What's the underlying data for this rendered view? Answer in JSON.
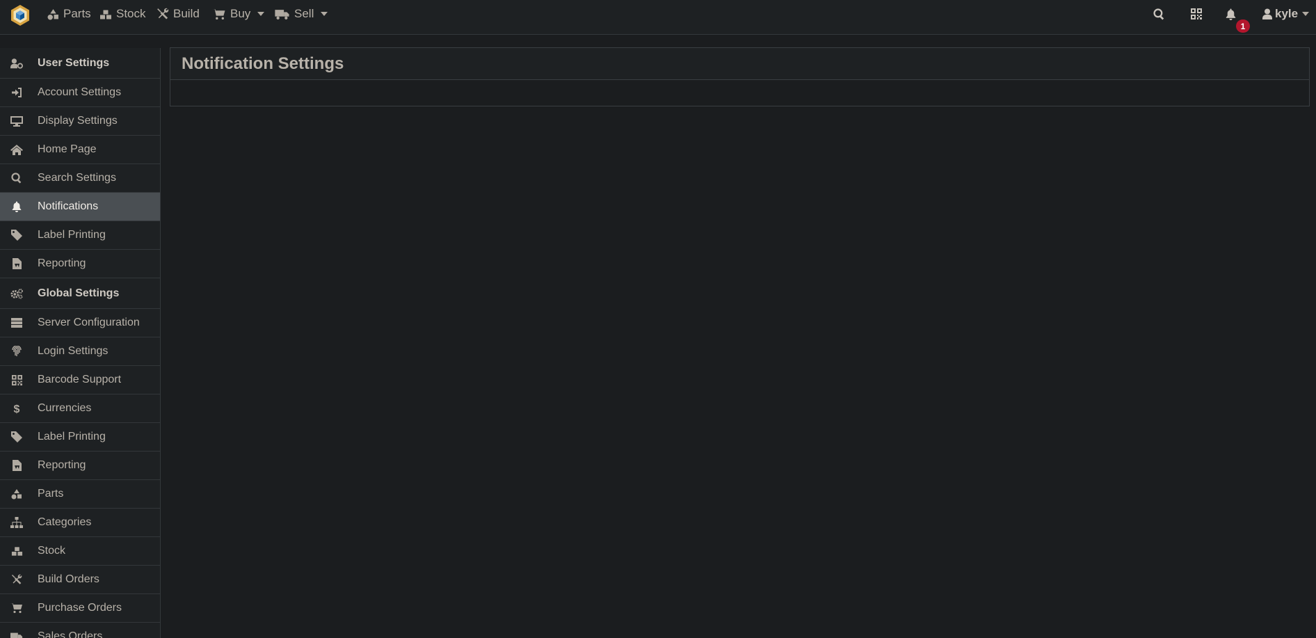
{
  "navbar": {
    "links": [
      {
        "label": "Parts",
        "icon": "shapes-icon",
        "dropdown": false
      },
      {
        "label": "Stock",
        "icon": "boxes-icon",
        "dropdown": false
      },
      {
        "label": "Build",
        "icon": "tools-icon",
        "dropdown": false
      },
      {
        "label": "Buy",
        "icon": "shopping-cart-icon",
        "dropdown": true
      },
      {
        "label": "Sell",
        "icon": "truck-icon",
        "dropdown": true
      }
    ],
    "notification_count": "1",
    "user": "kyle"
  },
  "sidebar": {
    "items": [
      {
        "label": "User Settings",
        "icon": "user-cog-icon",
        "type": "header"
      },
      {
        "label": "Account Settings",
        "icon": "sign-in-icon"
      },
      {
        "label": "Display Settings",
        "icon": "desktop-icon"
      },
      {
        "label": "Home Page",
        "icon": "home-icon"
      },
      {
        "label": "Search Settings",
        "icon": "search-icon"
      },
      {
        "label": "Notifications",
        "icon": "bell-icon",
        "active": true
      },
      {
        "label": "Label Printing",
        "icon": "tag-icon"
      },
      {
        "label": "Reporting",
        "icon": "file-pdf-icon"
      },
      {
        "label": "Global Settings",
        "icon": "cogs-icon",
        "type": "header"
      },
      {
        "label": "Server Configuration",
        "icon": "server-icon"
      },
      {
        "label": "Login Settings",
        "icon": "fingerprint-icon"
      },
      {
        "label": "Barcode Support",
        "icon": "qrcode-icon"
      },
      {
        "label": "Currencies",
        "icon": "dollar-icon"
      },
      {
        "label": "Label Printing",
        "icon": "tag-icon"
      },
      {
        "label": "Reporting",
        "icon": "file-pdf-icon"
      },
      {
        "label": "Parts",
        "icon": "shapes-icon"
      },
      {
        "label": "Categories",
        "icon": "sitemap-icon"
      },
      {
        "label": "Stock",
        "icon": "boxes-icon"
      },
      {
        "label": "Build Orders",
        "icon": "tools-icon"
      },
      {
        "label": "Purchase Orders",
        "icon": "shopping-cart-icon"
      },
      {
        "label": "Sales Orders",
        "icon": "truck-icon"
      }
    ]
  },
  "main": {
    "panel_title": "Notification Settings"
  },
  "colors": {
    "background": "#1b1d1f",
    "navbar": "#1e2123",
    "active_item": "#4a4f53",
    "badge": "#b3162d"
  }
}
